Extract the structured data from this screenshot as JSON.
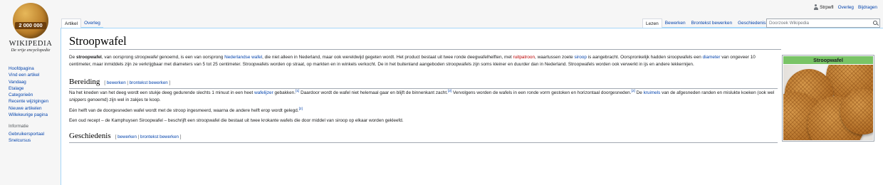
{
  "logo": {
    "badge": "2 000 000",
    "wordmark": "WIKIPEDIA",
    "tagline": "De vrije encyclopedie"
  },
  "sidebar": {
    "nav": [
      "Hoofdpagina",
      "Vind een artikel",
      "Vandaag",
      "Etalage",
      "Categorieën",
      "Recente wijzigingen",
      "Nieuwe artikelen",
      "Willekeurige pagina"
    ],
    "info_heading": "Informatie",
    "info": [
      "Gebruikersportaal",
      "Snelcursus"
    ]
  },
  "personal": {
    "user": "Strpwfl",
    "talk": "Overleg",
    "contributions": "Bijdragen"
  },
  "tabs": {
    "article": "Artikel",
    "talk": "Overleg",
    "read": "Lezen",
    "edit": "Bewerken",
    "edit_source": "Brontekst bewerken",
    "history": "Geschiedenis"
  },
  "search": {
    "placeholder": "Doorzoek Wikipedia"
  },
  "article": {
    "title": "Stroopwafel",
    "intro": {
      "t1": "De ",
      "b1": "stroopwafel",
      "t2": ", van oorsprong ",
      "i1": "stroopwafel",
      "t3": " genoemd, is een van oorsprong ",
      "l1": "Nederlandse wafel",
      "t4": ", die niet alleen in Nederland, maar ook wereldwijd gegeten wordt. Het product bestaat uit twee ronde deegwafelhelften, met ",
      "l2": "ruitpatroon",
      "t5": ", waartussen zoete ",
      "l3": "siroop",
      "t6": " is aangebracht. Oorspronkelijk hadden siroopwafels een ",
      "l4": "diameter",
      "t7": " van ongeveer 10 centimeter, maar inmiddels zijn ze verkrijgbaar met diameters van 5 tot 25 centimeter. Stroopwafels worden op straat, op markten en in winkels verkocht. De in het buitenland aangeboden stroopwafels zijn soms kleiner en duurder dan in Nederland. Stroopwafels worden ook verwerkt in ijs en andere lekkernijen."
    },
    "section1": {
      "title": "Bereiding",
      "edit_open": "[ ",
      "edit": "bewerken",
      "sep": " | ",
      "edit_source": "brontekst bewerken",
      "edit_close": " ]"
    },
    "p2": {
      "t1": "Na het kneden van het deeg wordt een stukje deeg gedurende slechts 1 minuut in een heet ",
      "l1": "wafelijzer",
      "t2": " gebakken.",
      "r1": "[1]",
      "t3": " Daardoor wordt de wafel niet helemaal gaar en blijft de binnenkant zacht.",
      "r2": "[2]",
      "t4": " Vervolgens worden de wafels in een ronde vorm gestoken en horizontaal doorgesneden.",
      "r3": "[2]",
      "t5": " De ",
      "l2": "kruimels",
      "t6": " van de afgesneden randen en mislukte koeken (ook wel ",
      "i1": "snippers",
      "t7": " genoemd) zijn wel in zakjes te koop."
    },
    "p3": {
      "t1": "Eén helft van de doorgesneden wafel wordt met de stroop ingesmeerd, waarna de andere helft erop wordt gelegd.",
      "r1": "[2]"
    },
    "p4": {
      "t1": "Een oud recept – de Kamphuysen Siroopwafel – beschrijft een stroopwafel die bestaat uit twee krokante wafels die door middel van siroop op elkaar worden gekleefd."
    },
    "section2": {
      "title": "Geschiedenis",
      "edit_open": "[ ",
      "edit": "bewerken",
      "sep": " | ",
      "edit_source": "brontekst bewerken",
      "edit_close": " ]"
    }
  },
  "infobox": {
    "title": "Stroopwafel",
    "image_icon": "stroopwafel-photo"
  },
  "colors": {
    "link": "#0645ad",
    "redlink": "#ba0000",
    "infobox_header": "#79c466"
  }
}
